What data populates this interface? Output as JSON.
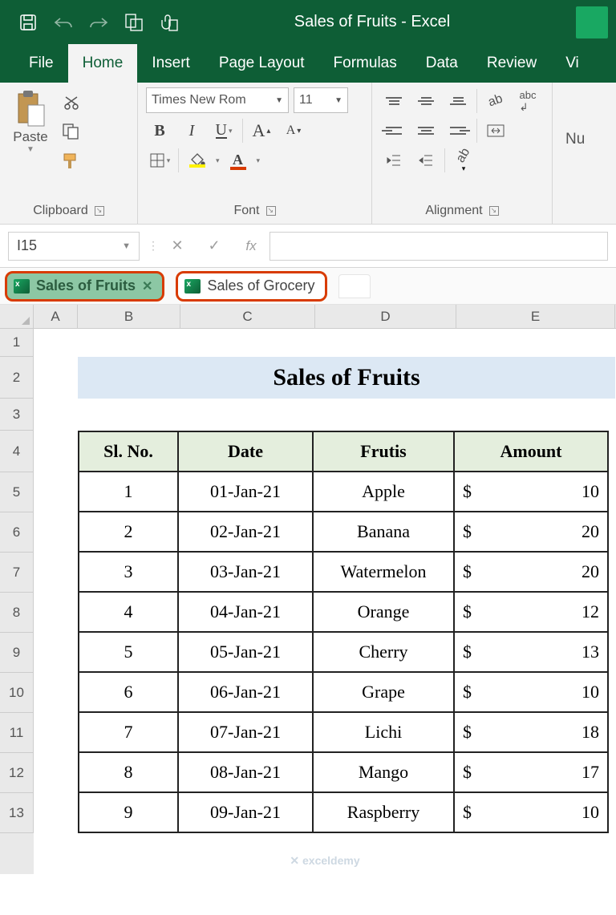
{
  "app": {
    "title": "Sales of Fruits  -  Excel"
  },
  "menu": {
    "file": "File",
    "home": "Home",
    "insert": "Insert",
    "pagelayout": "Page Layout",
    "formulas": "Formulas",
    "data": "Data",
    "review": "Review",
    "view": "Vi"
  },
  "ribbon": {
    "clipboard": {
      "paste": "Paste",
      "label": "Clipboard"
    },
    "font": {
      "name": "Times New Rom",
      "size": "11",
      "bold": "B",
      "italic": "I",
      "underline": "U",
      "growA": "A",
      "shrinkA": "A",
      "label": "Font",
      "colorA": "A"
    },
    "alignment": {
      "label": "Alignment"
    },
    "number": {
      "label": "Nu"
    }
  },
  "formulabar": {
    "namebox": "I15",
    "fx": "fx"
  },
  "wbtabs": {
    "active": "Sales of Fruits",
    "other": "Sales of Grocery"
  },
  "cols": {
    "A": "A",
    "B": "B",
    "C": "C",
    "D": "D",
    "E": "E"
  },
  "rows": [
    "1",
    "2",
    "3",
    "4",
    "5",
    "6",
    "7",
    "8",
    "9",
    "10",
    "11",
    "12",
    "13"
  ],
  "sheet": {
    "title": "Sales of Fruits",
    "headers": {
      "slno": "Sl. No.",
      "date": "Date",
      "fruit": "Frutis",
      "amount": "Amount"
    },
    "data": [
      {
        "sl": "1",
        "date": "01-Jan-21",
        "fruit": "Apple",
        "cur": "$",
        "amt": "10"
      },
      {
        "sl": "2",
        "date": "02-Jan-21",
        "fruit": "Banana",
        "cur": "$",
        "amt": "20"
      },
      {
        "sl": "3",
        "date": "03-Jan-21",
        "fruit": "Watermelon",
        "cur": "$",
        "amt": "20"
      },
      {
        "sl": "4",
        "date": "04-Jan-21",
        "fruit": "Orange",
        "cur": "$",
        "amt": "12"
      },
      {
        "sl": "5",
        "date": "05-Jan-21",
        "fruit": "Cherry",
        "cur": "$",
        "amt": "13"
      },
      {
        "sl": "6",
        "date": "06-Jan-21",
        "fruit": "Grape",
        "cur": "$",
        "amt": "10"
      },
      {
        "sl": "7",
        "date": "07-Jan-21",
        "fruit": "Lichi",
        "cur": "$",
        "amt": "18"
      },
      {
        "sl": "8",
        "date": "08-Jan-21",
        "fruit": "Mango",
        "cur": "$",
        "amt": "17"
      },
      {
        "sl": "9",
        "date": "09-Jan-21",
        "fruit": "Raspberry",
        "cur": "$",
        "amt": "10"
      }
    ]
  },
  "watermark": "✕ exceldemy"
}
